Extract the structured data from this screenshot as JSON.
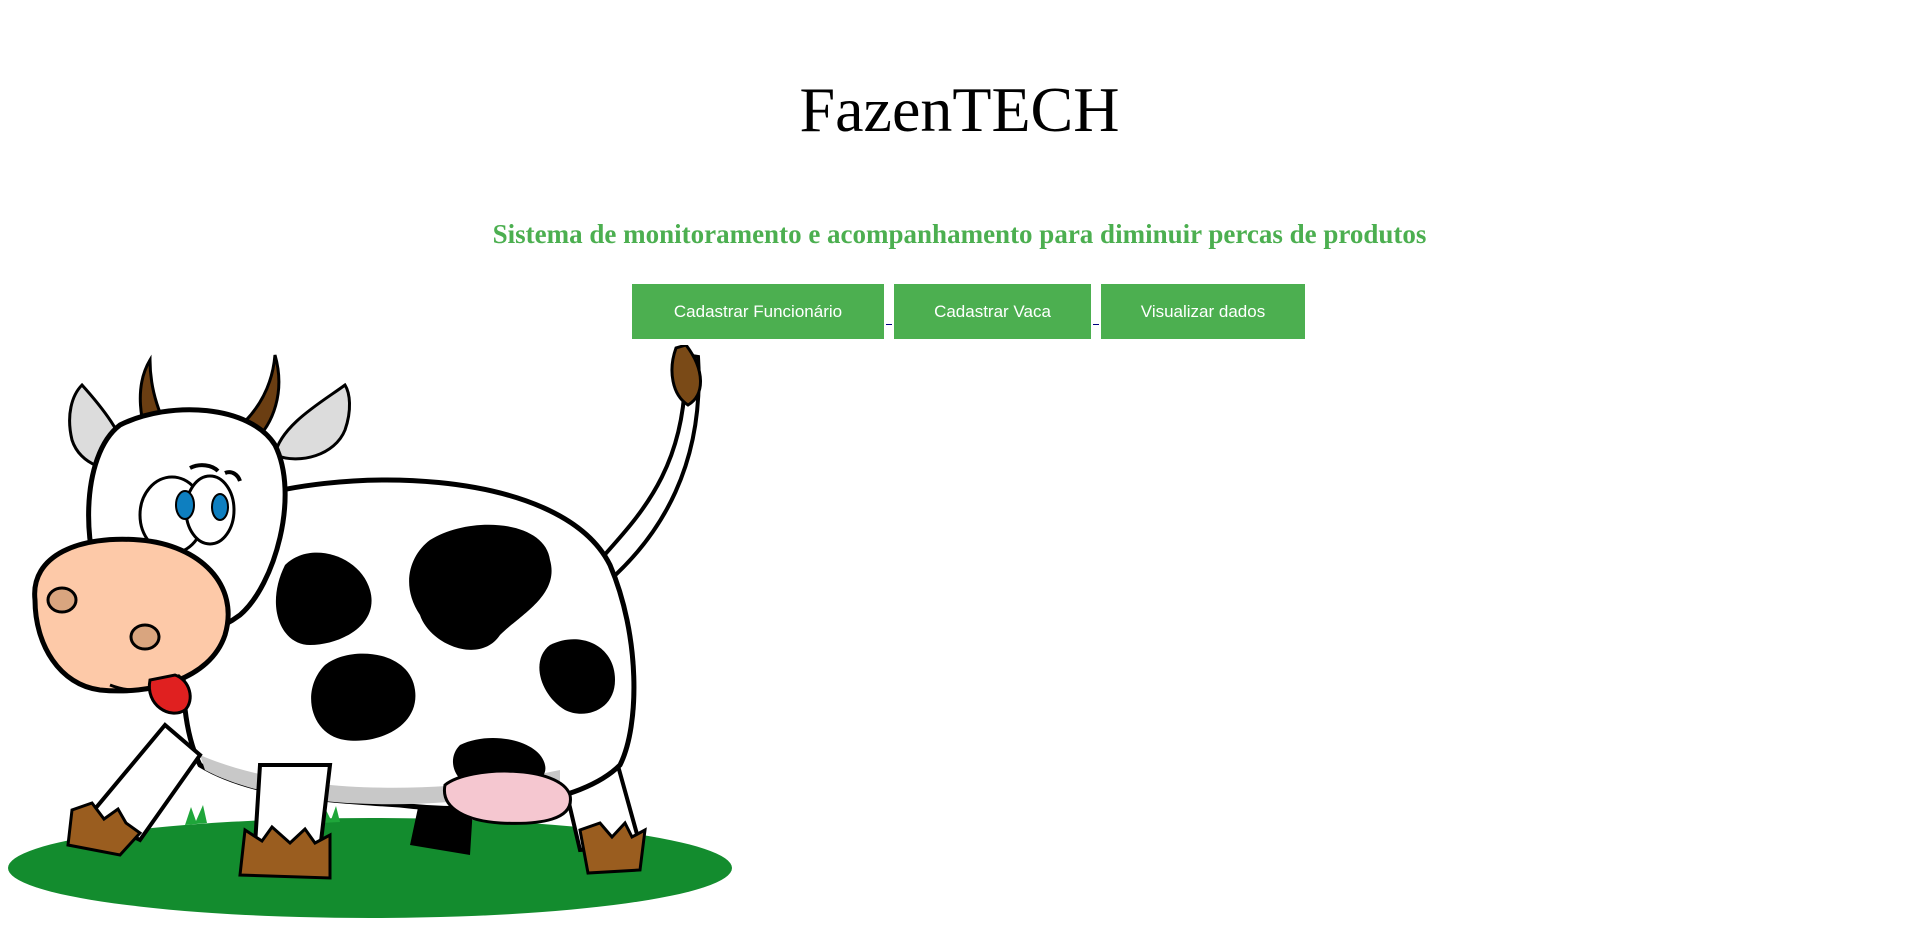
{
  "header": {
    "title": "FazenTECH",
    "subtitle": "Sistema de monitoramento e acompanhamento para diminuir percas de produtos"
  },
  "nav": {
    "buttons": [
      {
        "label": "Cadastrar Funcionário"
      },
      {
        "label": "Cadastrar Vaca"
      },
      {
        "label": "Visualizar dados"
      }
    ]
  },
  "colors": {
    "accent": "#4caf50",
    "button_text": "#ffffff",
    "title_text": "#000000"
  },
  "illustration": {
    "icon": "cartoon-cow-illustration"
  }
}
